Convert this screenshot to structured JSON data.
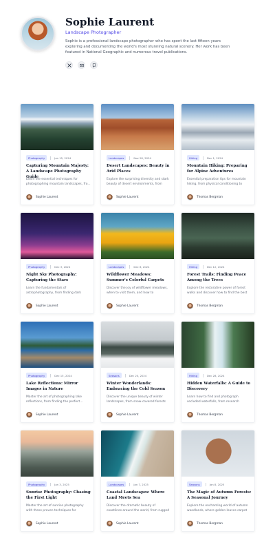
{
  "profile": {
    "name": "Sophie Laurent",
    "role": "Landscape Photographer",
    "bio": "Sophie is a professional landscape photographer who has spent the last fifteen years exploring and documenting the world's most stunning natural scenery. Her work has been featured in National Geographic and numerous travel publications.",
    "socials": [
      "x-icon",
      "mail-icon",
      "message-icon"
    ]
  },
  "posts": [
    {
      "category": "Photography",
      "date": "Jan 15, 2024",
      "title": "Capturing Mountain Majesty: A Landscape Photography Guide",
      "excerpt": "Learn the essential techniques for photographing mountain landscapes, fro...",
      "author": "Sophie Laurent",
      "image": "mountain-lake"
    },
    {
      "category": "Landscapes",
      "date": "Nov 28, 2024",
      "title": "Desert Landscapes: Beauty in Arid Places",
      "excerpt": "Explore the surprising diversity and stark beauty of desert environments, from sand...",
      "author": "Sophie Laurent",
      "image": "desert-canyon"
    },
    {
      "category": "Hiking",
      "date": "Dec 1, 2024",
      "title": "Mountain Hiking: Preparing for Alpine Adventures",
      "excerpt": "Essential preparation tips for mountain hiking, from physical conditioning to gear...",
      "author": "Thomas Bergman",
      "image": "snowy-peaks"
    },
    {
      "category": "Photography",
      "date": "Dec 3, 2024",
      "title": "Night Sky Photography: Capturing the Stars",
      "excerpt": "Learn the fundamentals of astrophotography, from finding dark skies...",
      "author": "Sophie Laurent",
      "image": "night-sky"
    },
    {
      "category": "Landscapes",
      "date": "Dec 8, 2024",
      "title": "Wildflower Meadows: Summer's Colorful Carpets",
      "excerpt": "Discover the joy of wildflower meadows, when to visit them, and how to photograp...",
      "author": "Sophie Laurent",
      "image": "wildflowers"
    },
    {
      "category": "Hiking",
      "date": "Dec 12, 2024",
      "title": "Forest Trails: Finding Peace Among the Trees",
      "excerpt": "Explore the restorative power of forest walks and discover how to find the best woodlan...",
      "author": "Thomas Bergman",
      "image": "forest"
    },
    {
      "category": "Photography",
      "date": "Dec 15, 2024",
      "title": "Lake Reflections: Mirror Images in Nature",
      "excerpt": "Master the art of photographing lake reflections, from finding the perfect...",
      "author": "Sophie Laurent",
      "image": "lake-dock"
    },
    {
      "category": "Seasons",
      "date": "Dec 20, 2024",
      "title": "Winter Wonderlands: Embracing the Cold Season",
      "excerpt": "Discover the unique beauty of winter landscapes, from snow-covered forests to...",
      "author": "Sophie Laurent",
      "image": "winter-forest"
    },
    {
      "category": "Hiking",
      "date": "Dec 28, 2024",
      "title": "Hidden Waterfalls: A Guide to Discovery",
      "excerpt": "Learn how to find and photograph secluded waterfalls, from research techniques to...",
      "author": "Thomas Bergman",
      "image": "waterfall"
    },
    {
      "category": "Photography",
      "date": "Jan 3, 2025",
      "title": "Sunrise Photography: Chasing the First Light",
      "excerpt": "Master the art of sunrise photography with these proven techniques for capturing the...",
      "author": "Sophie Laurent",
      "image": "misty-hills"
    },
    {
      "category": "Landscapes",
      "date": "Jan 7, 2025",
      "title": "Coastal Landscapes: Where Land Meets Sea",
      "excerpt": "Discover the dramatic beauty of coastlines around the world, from rugged cliffs to...",
      "author": "Sophie Laurent",
      "image": "coast-aerial"
    },
    {
      "category": "Seasons",
      "date": "Jan 8, 2025",
      "title": "The Magic of Autumn Forests: A Seasonal Journey",
      "excerpt": "Explore the enchanting world of autumn woodlands, where golden leaves carpet th...",
      "author": "Thomas Bergman",
      "image": "portrait"
    }
  ]
}
